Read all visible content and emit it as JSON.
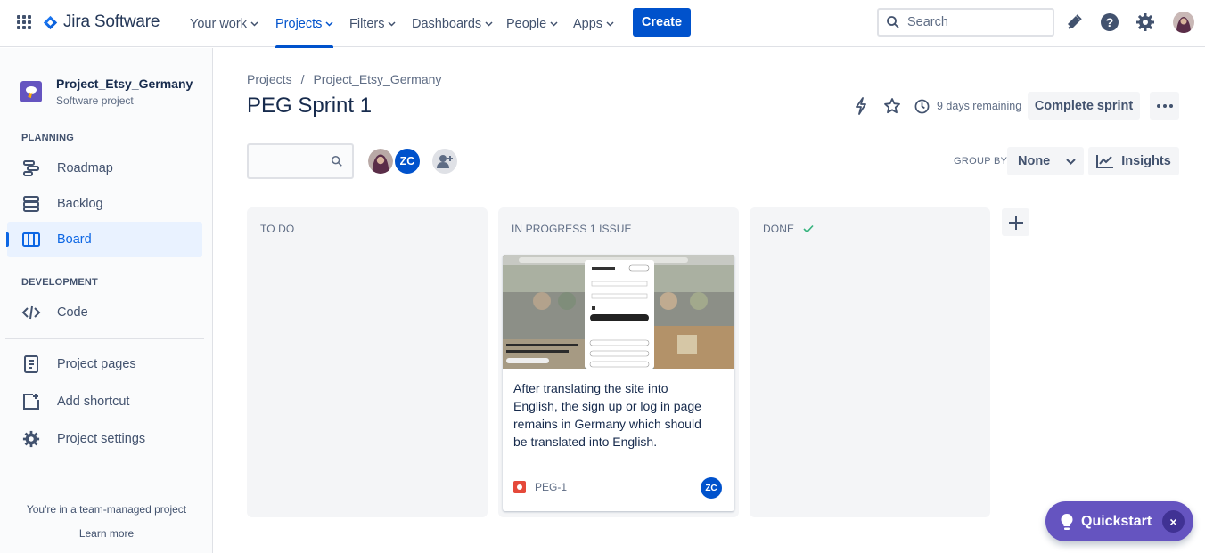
{
  "topnav": {
    "product": "Jira Software",
    "items": [
      {
        "label": "Your work"
      },
      {
        "label": "Projects"
      },
      {
        "label": "Filters"
      },
      {
        "label": "Dashboards"
      },
      {
        "label": "People"
      },
      {
        "label": "Apps"
      }
    ],
    "create_label": "Create",
    "search_placeholder": "Search"
  },
  "sidebar": {
    "project_name": "Project_Etsy_Germany",
    "project_type": "Software project",
    "planning_label": "PLANNING",
    "development_label": "DEVELOPMENT",
    "items": [
      {
        "label": "Roadmap"
      },
      {
        "label": "Backlog"
      },
      {
        "label": "Board"
      },
      {
        "label": "Code"
      },
      {
        "label": "Project pages"
      },
      {
        "label": "Add shortcut"
      },
      {
        "label": "Project settings"
      }
    ],
    "team_message": "You're in a team-managed project",
    "learn_more": "Learn more"
  },
  "main": {
    "breadcrumb": [
      "Projects",
      "/",
      "Project_Etsy_Germany"
    ],
    "title": "PEG Sprint 1",
    "days_remaining": "9 days remaining",
    "complete_sprint_label": "Complete sprint",
    "group_by_label": "GROUP BY",
    "group_by_value": "None",
    "insights_label": "Insights",
    "assignee_initials": "ZC"
  },
  "columns": [
    {
      "title": "TO DO"
    },
    {
      "title": "IN PROGRESS 1 ISSUE"
    },
    {
      "title": "DONE"
    }
  ],
  "card": {
    "text": "After translating the site into English, the sign up or log in page remains in Germany which should be translated into English.",
    "key": "PEG-1",
    "assignee": "ZC"
  },
  "quickstart": {
    "label": "Quickstart",
    "close": "×"
  },
  "colors": {
    "brand_blue": "#0052cc",
    "quickstart_purple": "#6554c0",
    "bug_red": "#e5493a",
    "done_check_green": "#36b37e"
  }
}
